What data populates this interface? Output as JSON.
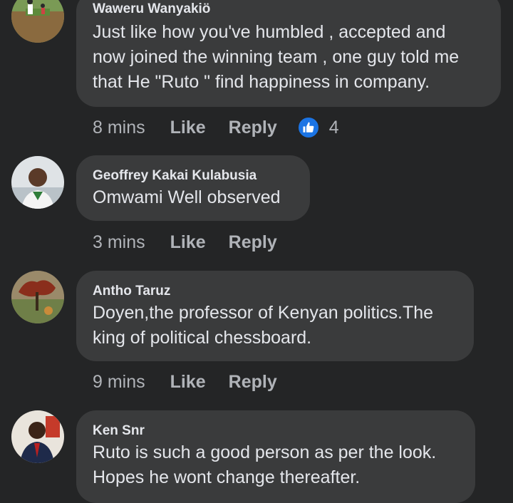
{
  "comments": [
    {
      "author": "Waweru Wanyakiö",
      "lines": [
        "Just like how you've humbled , accepted and",
        "now joined the winning team , one guy told me",
        "that He \"Ruto \" find happiness in company."
      ],
      "time": "8 mins",
      "like_label": "Like",
      "reply_label": "Reply",
      "reaction_icon": "thumbs-up-icon",
      "reaction_count": "4"
    },
    {
      "author": "Geoffrey Kakai Kulabusia",
      "lines": [
        "Omwami Well observed"
      ],
      "time": "3 mins",
      "like_label": "Like",
      "reply_label": "Reply"
    },
    {
      "author": "Antho Taruz",
      "lines": [
        "Doyen,the professor of Kenyan politics.The",
        "king of political chessboard."
      ],
      "time": "9 mins",
      "like_label": "Like",
      "reply_label": "Reply"
    },
    {
      "author": "Ken Snr",
      "lines": [
        "Ruto is such a good person as per the look.",
        "Hopes he wont change thereafter."
      ]
    }
  ],
  "colors": {
    "background": "#242526",
    "bubble": "#3a3b3c",
    "primary_text": "#e4e6eb",
    "secondary_text": "#b0b3b8",
    "like_blue": "#1b74e4"
  }
}
